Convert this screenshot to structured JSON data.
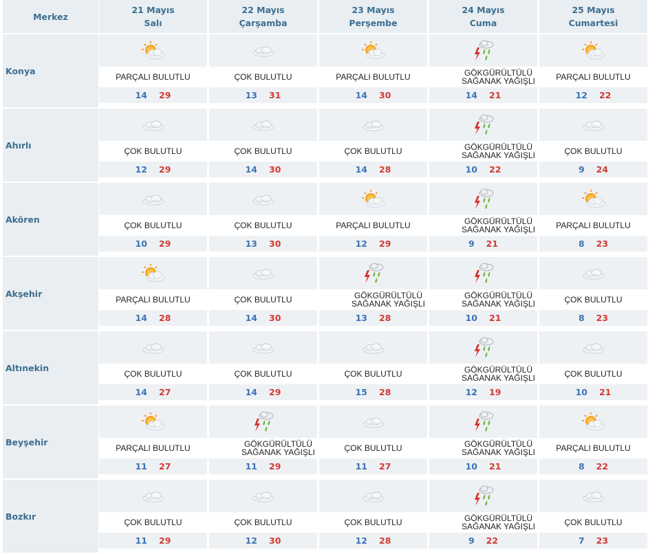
{
  "header": {
    "merkez_label": "Merkez",
    "days": [
      {
        "date": "21 Mayıs",
        "weekday": "Salı"
      },
      {
        "date": "22 Mayıs",
        "weekday": "Çarşamba"
      },
      {
        "date": "23 Mayıs",
        "weekday": "Perşembe"
      },
      {
        "date": "24 Mayıs",
        "weekday": "Cuma"
      },
      {
        "date": "25 Mayıs",
        "weekday": "Cumartesi"
      }
    ]
  },
  "cities": [
    {
      "name": "Konya",
      "days": [
        {
          "icon": "partly-cloudy-icon",
          "desc": "PARÇALI BULUTLU",
          "min": "14",
          "max": "29"
        },
        {
          "icon": "cloudy-icon",
          "desc": "ÇOK BULUTLU",
          "min": "13",
          "max": "31"
        },
        {
          "icon": "partly-cloudy-icon",
          "desc": "PARÇALI BULUTLU",
          "min": "14",
          "max": "30"
        },
        {
          "icon": "thunderstorm-icon",
          "desc": "GÖKGÜRÜLTÜLÜ SAĞANAK YAĞIŞLI",
          "min": "14",
          "max": "21"
        },
        {
          "icon": "partly-cloudy-icon",
          "desc": "PARÇALI BULUTLU",
          "min": "12",
          "max": "22"
        }
      ]
    },
    {
      "name": "Ahırlı",
      "days": [
        {
          "icon": "cloudy-icon",
          "desc": "ÇOK BULUTLU",
          "min": "12",
          "max": "29"
        },
        {
          "icon": "cloudy-icon",
          "desc": "ÇOK BULUTLU",
          "min": "14",
          "max": "30"
        },
        {
          "icon": "cloudy-icon",
          "desc": "ÇOK BULUTLU",
          "min": "14",
          "max": "28"
        },
        {
          "icon": "thunderstorm-icon",
          "desc": "GÖKGÜRÜLTÜLÜ SAĞANAK YAĞIŞLI",
          "min": "10",
          "max": "22"
        },
        {
          "icon": "cloudy-icon",
          "desc": "ÇOK BULUTLU",
          "min": "9",
          "max": "24"
        }
      ]
    },
    {
      "name": "Akören",
      "days": [
        {
          "icon": "cloudy-icon",
          "desc": "ÇOK BULUTLU",
          "min": "10",
          "max": "29"
        },
        {
          "icon": "cloudy-icon",
          "desc": "ÇOK BULUTLU",
          "min": "13",
          "max": "30"
        },
        {
          "icon": "partly-cloudy-icon",
          "desc": "PARÇALI BULUTLU",
          "min": "12",
          "max": "29"
        },
        {
          "icon": "thunderstorm-icon",
          "desc": "GÖKGÜRÜLTÜLÜ SAĞANAK YAĞIŞLI",
          "min": "9",
          "max": "21"
        },
        {
          "icon": "partly-cloudy-icon",
          "desc": "PARÇALI BULUTLU",
          "min": "8",
          "max": "23"
        }
      ]
    },
    {
      "name": "Akşehir",
      "days": [
        {
          "icon": "partly-cloudy-icon",
          "desc": "PARÇALI BULUTLU",
          "min": "14",
          "max": "28"
        },
        {
          "icon": "cloudy-icon",
          "desc": "ÇOK BULUTLU",
          "min": "14",
          "max": "30"
        },
        {
          "icon": "thunderstorm-icon",
          "desc": "GÖKGÜRÜLTÜLÜ SAĞANAK YAĞIŞLI",
          "min": "13",
          "max": "28"
        },
        {
          "icon": "thunderstorm-icon",
          "desc": "GÖKGÜRÜLTÜLÜ SAĞANAK YAĞIŞLI",
          "min": "10",
          "max": "21"
        },
        {
          "icon": "cloudy-icon",
          "desc": "ÇOK BULUTLU",
          "min": "8",
          "max": "23"
        }
      ]
    },
    {
      "name": "Altınekin",
      "days": [
        {
          "icon": "cloudy-icon",
          "desc": "ÇOK BULUTLU",
          "min": "14",
          "max": "27"
        },
        {
          "icon": "cloudy-icon",
          "desc": "ÇOK BULUTLU",
          "min": "14",
          "max": "29"
        },
        {
          "icon": "cloudy-icon",
          "desc": "ÇOK BULUTLU",
          "min": "15",
          "max": "28"
        },
        {
          "icon": "thunderstorm-icon",
          "desc": "GÖKGÜRÜLTÜLÜ SAĞANAK YAĞIŞLI",
          "min": "12",
          "max": "19"
        },
        {
          "icon": "cloudy-icon",
          "desc": "ÇOK BULUTLU",
          "min": "10",
          "max": "21"
        }
      ]
    },
    {
      "name": "Beyşehir",
      "days": [
        {
          "icon": "partly-cloudy-icon",
          "desc": "PARÇALI BULUTLU",
          "min": "11",
          "max": "27"
        },
        {
          "icon": "thunderstorm-icon",
          "desc": "GÖKGÜRÜLTÜLÜ SAĞANAK YAĞIŞLI",
          "min": "11",
          "max": "29"
        },
        {
          "icon": "cloudy-icon",
          "desc": "ÇOK BULUTLU",
          "min": "11",
          "max": "27"
        },
        {
          "icon": "thunderstorm-icon",
          "desc": "GÖKGÜRÜLTÜLÜ SAĞANAK YAĞIŞLI",
          "min": "10",
          "max": "21"
        },
        {
          "icon": "partly-cloudy-icon",
          "desc": "PARÇALI BULUTLU",
          "min": "8",
          "max": "22"
        }
      ]
    },
    {
      "name": "Bozkır",
      "days": [
        {
          "icon": "cloudy-icon",
          "desc": "ÇOK BULUTLU",
          "min": "11",
          "max": "29"
        },
        {
          "icon": "cloudy-icon",
          "desc": "ÇOK BULUTLU",
          "min": "12",
          "max": "30"
        },
        {
          "icon": "cloudy-icon",
          "desc": "ÇOK BULUTLU",
          "min": "12",
          "max": "28"
        },
        {
          "icon": "thunderstorm-icon",
          "desc": "GÖKGÜRÜLTÜLÜ SAĞANAK YAĞIŞLI",
          "min": "9",
          "max": "22"
        },
        {
          "icon": "cloudy-icon",
          "desc": "ÇOK BULUTLU",
          "min": "7",
          "max": "23"
        }
      ]
    }
  ],
  "colors": {
    "header_text": "#3d6e8e",
    "min_temp": "#3c73b4",
    "max_temp": "#d13a34",
    "band_bg": "#eef1f4"
  }
}
